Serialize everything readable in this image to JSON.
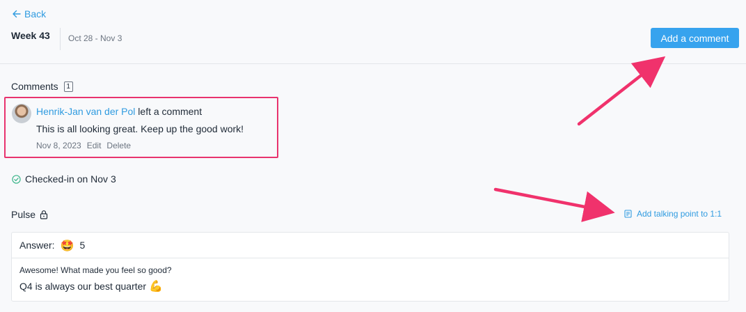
{
  "header": {
    "back_label": "Back",
    "week_title": "Week 43",
    "week_range": "Oct 28 - Nov 3",
    "add_comment_label": "Add a comment"
  },
  "comments": {
    "heading": "Comments",
    "count": "1",
    "items": [
      {
        "author": "Henrik-Jan van der Pol",
        "action_text": " left a comment",
        "body": "This is all looking great. Keep up the good work!",
        "date": "Nov 8, 2023",
        "edit_label": "Edit",
        "delete_label": "Delete"
      }
    ]
  },
  "checkin": {
    "label": "Checked-in on Nov 3"
  },
  "pulse": {
    "heading": "Pulse",
    "talking_point_label": "Add talking point to 1:1",
    "answer_label": "Answer:",
    "answer_emoji": "🤩",
    "answer_value": "5",
    "question": "Awesome! What made you feel so good?",
    "response": "Q4 is always our best quarter",
    "response_emoji": "💪"
  },
  "colors": {
    "accent": "#37a3ee",
    "link": "#2f9be0",
    "highlight": "#e8336e",
    "success": "#3bb58a"
  },
  "icons": [
    "arrow-left-icon",
    "check-circle-icon",
    "lock-icon",
    "note-icon"
  ]
}
